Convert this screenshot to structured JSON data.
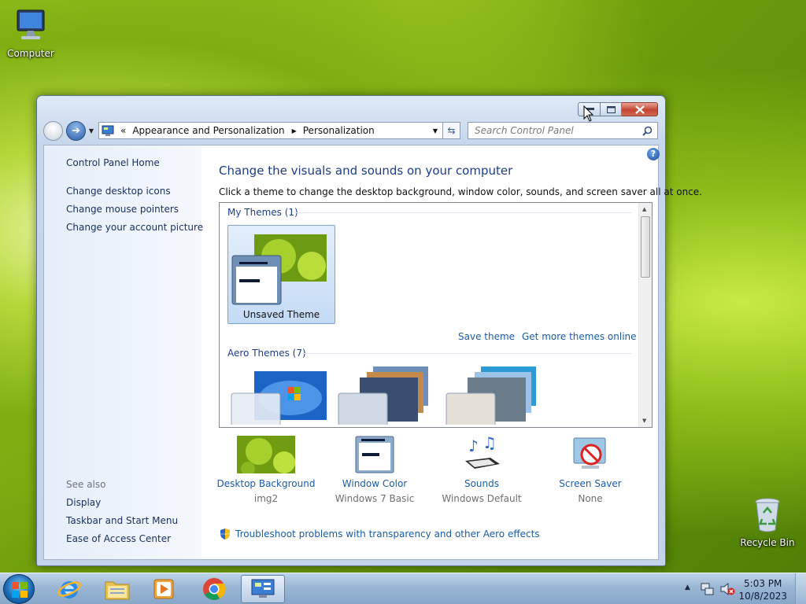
{
  "desktop": {
    "icons": [
      {
        "label": "Computer"
      },
      {
        "label": "Recycle Bin"
      }
    ]
  },
  "window": {
    "breadcrumb": {
      "overflow": "«",
      "items": [
        "Appearance and Personalization",
        "Personalization"
      ]
    },
    "search_placeholder": "Search Control Panel",
    "sidebar": {
      "home": "Control Panel Home",
      "links": [
        "Change desktop icons",
        "Change mouse pointers",
        "Change your account picture"
      ],
      "see_also_header": "See also",
      "see_also": [
        "Display",
        "Taskbar and Start Menu",
        "Ease of Access Center"
      ]
    },
    "heading": "Change the visuals and sounds on your computer",
    "subheading": "Click a theme to change the desktop background, window color, sounds, and screen saver all at once.",
    "groups": {
      "my_themes": "My Themes (1)",
      "aero_themes": "Aero Themes (7)"
    },
    "my_themes": [
      {
        "label": "Unsaved Theme",
        "selected": true
      }
    ],
    "theme_actions": {
      "save": "Save theme",
      "more": "Get more themes online"
    },
    "settings": [
      {
        "label": "Desktop Background",
        "value": "img2"
      },
      {
        "label": "Window Color",
        "value": "Windows 7 Basic"
      },
      {
        "label": "Sounds",
        "value": "Windows Default"
      },
      {
        "label": "Screen Saver",
        "value": "None"
      }
    ],
    "troubleshoot": "Troubleshoot problems with transparency and other Aero effects"
  },
  "taskbar": {
    "apps": [
      "internet-explorer",
      "file-explorer",
      "media-player",
      "chrome",
      "control-panel"
    ],
    "active": "control-panel",
    "clock": {
      "time": "5:03 PM",
      "date": "10/8/2023"
    }
  },
  "colors": {
    "link": "#1a5ca8",
    "heading": "#1e3c88",
    "close_button": "#c44432"
  }
}
